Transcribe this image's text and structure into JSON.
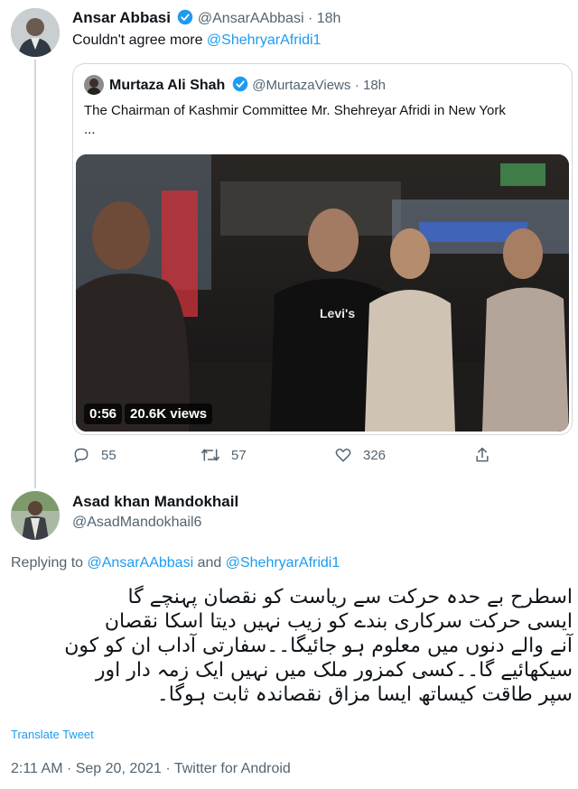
{
  "parent_tweet": {
    "author_name": "Ansar Abbasi",
    "handle": "@AnsarAAbbasi",
    "time": "· 18h",
    "text_prefix": "Couldn't agree more ",
    "mention": "@ShehryarAfridi1"
  },
  "quoted_tweet": {
    "author_name": "Murtaza Ali Shah",
    "handle": "@MurtazaViews",
    "time": "· 18h",
    "text": "The Chairman of Kashmir Committee Mr. Shehreyar Afridi in New York",
    "ellipsis": "...",
    "video": {
      "duration": "0:56",
      "views": "20.6K views",
      "shirt_text": "Levi's"
    }
  },
  "actions": {
    "replies": "55",
    "retweets": "57",
    "likes": "326"
  },
  "reply_tweet": {
    "author_name": "Asad khan Mandokhail",
    "handle": "@AsadMandokhail6",
    "replying_prefix": "Replying to ",
    "replying_user_1": "@AnsarAAbbasi",
    "replying_and": " and ",
    "replying_user_2": "@ShehryarAfridi1",
    "text_lines": [
      "اسطرح بے حدہ حرکت سے ریاست کو نقصان پہنچے گا",
      "ایسی حرکت سرکاری بندے کو زیب نہیں دیتا اسکا نقصان",
      "آنے والے دنوں میں معلوم ہو جائیگا۔۔سفارتی آداب ان کو کون",
      "سیکھائیے گا۔۔کسی کمزور ملک میں نہیں ایک زمہ دار اور",
      "سپر طاقت کیساتھ ایسا مزاق نقصاندہ ثابت ہوگا۔"
    ],
    "translate_label": "Translate Tweet",
    "timestamp": "2:11 AM · Sep 20, 2021 · Twitter for Android"
  },
  "colors": {
    "accent": "#1d9bf0",
    "muted": "#536471",
    "border": "#cfd9de"
  }
}
